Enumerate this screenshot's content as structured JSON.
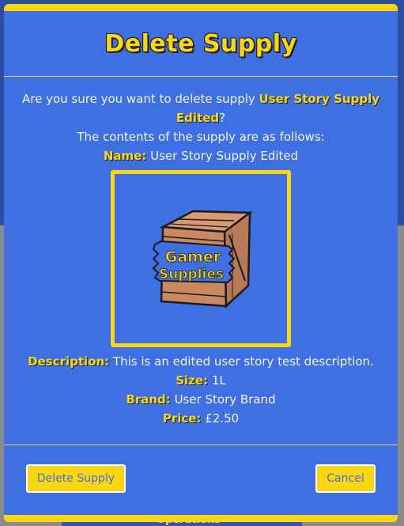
{
  "modal": {
    "title": "Delete Supply",
    "confirm_prefix": "Are you sure you want to delete supply ",
    "supply_name_highlight": "User Story Supply Edited",
    "confirm_suffix": "?",
    "contents_intro": "The contents of the supply are as follows:",
    "fields": {
      "name_label": "Name:",
      "name_value": "User Story Supply Edited",
      "description_label": "Description:",
      "description_value": "This is an edited user story test description.",
      "size_label": "Size:",
      "size_value": "1L",
      "brand_label": "Brand:",
      "brand_value": "User Story Brand",
      "price_label": "Price:",
      "price_value": "£2.50"
    },
    "image_text": {
      "line1": "Gamer",
      "line2": "Supplies"
    },
    "buttons": {
      "delete_label": "Delete Supply",
      "cancel_label": "Cancel"
    }
  },
  "backdrop": {
    "partial_text": "Operations"
  },
  "colors": {
    "modal_bg": "#3f70e3",
    "accent_yellow": "#fbd711",
    "text_light": "#f4f4f4"
  }
}
